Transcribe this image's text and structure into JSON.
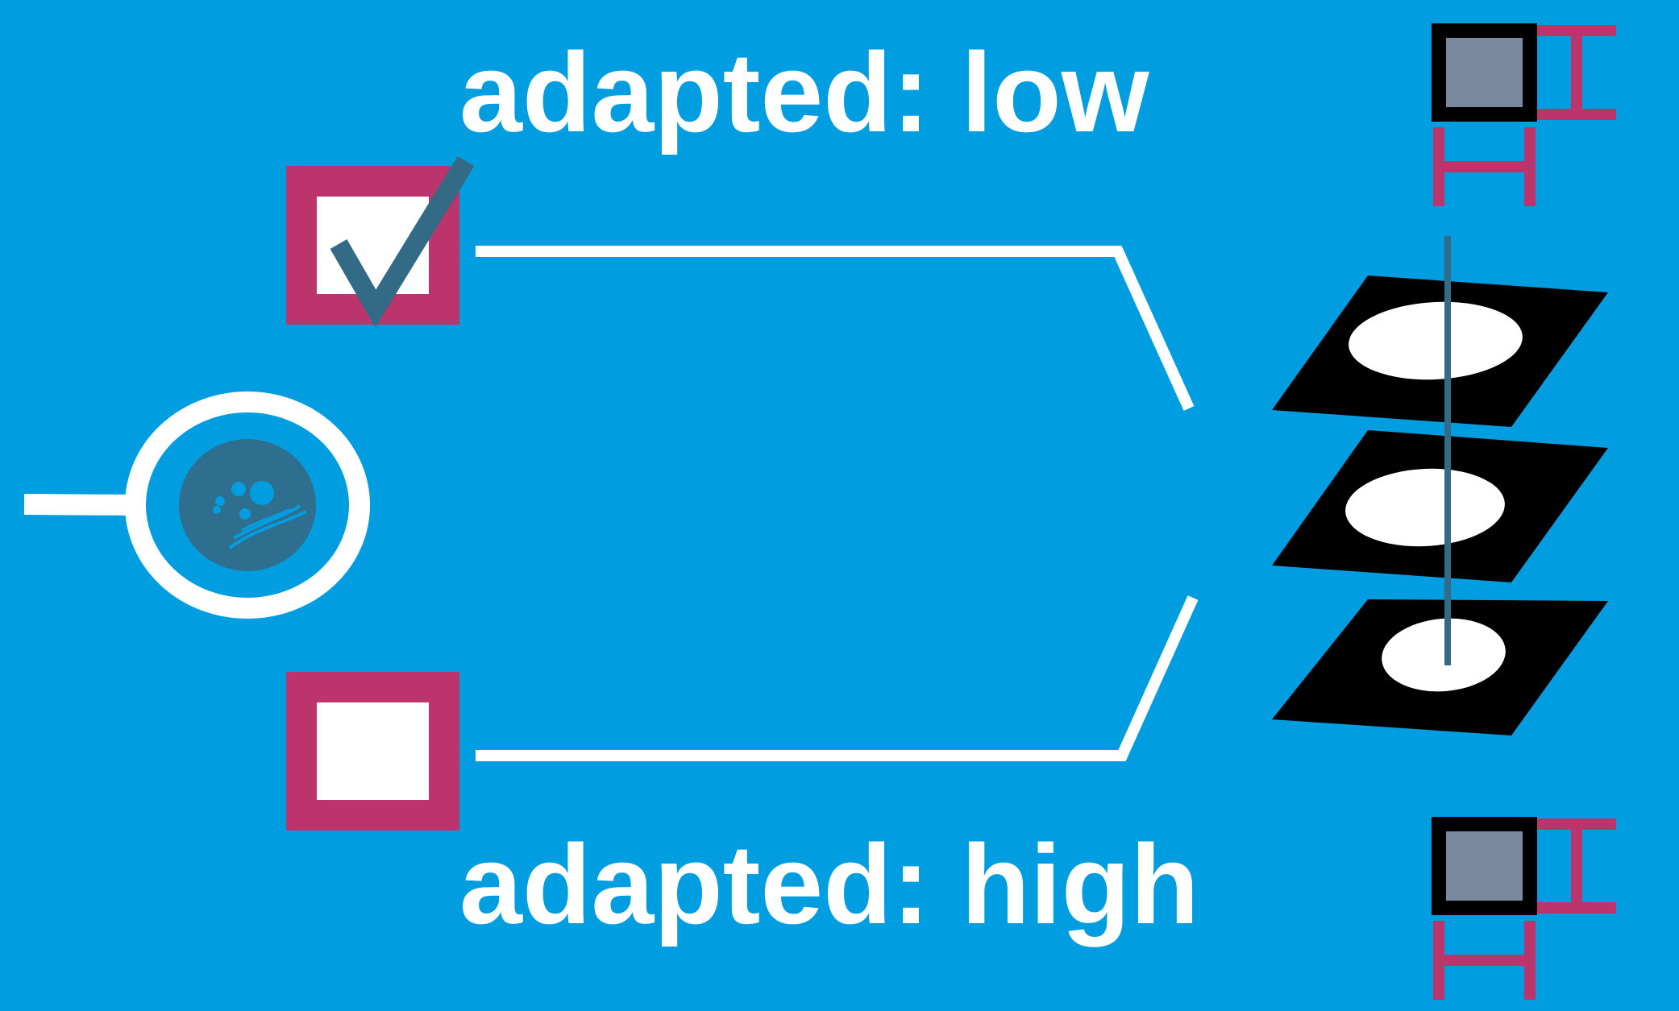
{
  "labels": {
    "top": "adapted: low",
    "bottom": "adapted: high"
  },
  "checkboxes": [
    {
      "id": "top",
      "checked": true
    },
    {
      "id": "bottom",
      "checked": false
    }
  ],
  "colors": {
    "background": "#009ee0",
    "box_border": "#bb346b",
    "check_mark": "#336b87",
    "lines": "#ffffff",
    "layers": "#000000",
    "lens_fill": "#2e6e8e",
    "mini_square": "#7a8a9e"
  },
  "icons": {
    "magnifier": "magnifier-cell-icon",
    "layers": "layer-stack-icon",
    "mini_chart": "mini-box-icon",
    "checkmark": "checkmark-icon"
  }
}
